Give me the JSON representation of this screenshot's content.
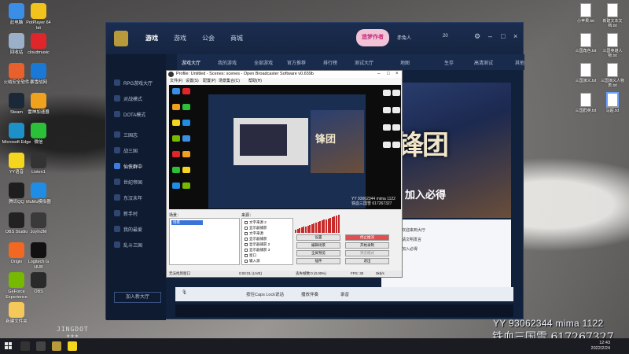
{
  "desktop_left_icons": [
    {
      "label": "此电脑",
      "color": "#3a8ee6"
    },
    {
      "label": "PotPlayer 64 bit",
      "color": "#f2c21d"
    },
    {
      "label": "回收站",
      "color": "#9ab0c8"
    },
    {
      "label": "cloudmusic",
      "color": "#e0262b"
    },
    {
      "label": "火绒安全软件",
      "color": "#e8602c"
    },
    {
      "label": "暴雪战网",
      "color": "#1a78d6"
    },
    {
      "label": "Steam",
      "color": "#1b2838"
    },
    {
      "label": "雷神加速器",
      "color": "#f0a21e"
    },
    {
      "label": "Microsoft Edge",
      "color": "#1e90c8"
    },
    {
      "label": "微信",
      "color": "#2bbf3a"
    },
    {
      "label": "YY语音",
      "color": "#f5d61e"
    },
    {
      "label": "Listen1",
      "color": "#333333"
    },
    {
      "label": "腾讯QQ",
      "color": "#1e1e1e"
    },
    {
      "label": "MuMu模拟器",
      "color": "#1f8ce6"
    },
    {
      "label": "OBS Studio",
      "color": "#222222"
    },
    {
      "label": "JoyIn2M",
      "color": "#3a3a3a"
    },
    {
      "label": "Origin",
      "color": "#f26722"
    },
    {
      "label": "Logitech G HUB",
      "color": "#111111"
    },
    {
      "label": "GeForce Experience",
      "color": "#76b900"
    },
    {
      "label": "OBS",
      "color": "#2a2a2a"
    },
    {
      "label": "新建文件夹",
      "color": "#f4c95a"
    }
  ],
  "desktop_right_icons": [
    {
      "label": "小苹果.txt"
    },
    {
      "label": "新建文本文档.txt"
    },
    {
      "label": "三国角色.txt"
    },
    {
      "label": "三国英雄人物.txt"
    },
    {
      "label": "三国演义.txt"
    },
    {
      "label": "三国演义人物表.txt"
    },
    {
      "label": "三国群英.txt"
    },
    {
      "label": "马超.txt"
    }
  ],
  "launcher": {
    "nav": [
      "游戏",
      "游戏",
      "公会",
      "商城"
    ],
    "promo": "造梦作者",
    "user": "赤兔人",
    "user_badge": "20",
    "sidebar": [
      {
        "label": "RPG游戏大厅",
        "active": false
      },
      {
        "label": "对战模式",
        "active": false
      },
      {
        "label": "DOTA模式",
        "active": false
      },
      {
        "label": "三国志",
        "active": false
      },
      {
        "label": "战三国",
        "active": false
      },
      {
        "label": "仙侠群中",
        "active": true
      },
      {
        "label": "世纪帝国",
        "active": false
      },
      {
        "label": "东汉末年",
        "active": false
      },
      {
        "label": "新手村",
        "active": false
      },
      {
        "label": "我的最爱",
        "active": false
      },
      {
        "label": "乱斗三国",
        "active": false
      }
    ],
    "add_game": "加入新大厅",
    "subtabs": [
      "游戏大厅",
      "我的游戏",
      "全部游戏",
      "官方推荐",
      "排行榜",
      "测试大厅",
      "地图",
      "生存",
      "高清测试",
      "其他"
    ],
    "banner_title": "锋团",
    "banner_sub": "加入必得",
    "chat_lines": [
      "【系统】欢迎来到大厅",
      "【公告】请文明发言",
      "【用户】加入必得"
    ],
    "toolbar": [
      "按住Caps Lock说话",
      "播放伴奏",
      "录音"
    ]
  },
  "obs": {
    "title": "Profile: Untitled - Scenes: scenes - Open Broadcaster Software v0.659b",
    "menu": [
      "文件(F)",
      "设置(S)",
      "配置(P)",
      "场景集合(C)",
      "帮助(H)"
    ],
    "scenes_header": "场景：",
    "sources_header": "来源：",
    "scene_item": "场景",
    "sources": [
      "文字来源 2",
      "显示器捕获",
      "文字来源",
      "显示器捕获",
      "显示器捕获 2",
      "显示器捕获 3",
      "窗口",
      "输入源"
    ],
    "buttons": {
      "settings": "设置",
      "start_stream": "停止推流",
      "edit_scene": "编辑场景",
      "start_record": "开始录制",
      "fullscreen_preview": "全屏预览",
      "stop_preview": "预览模式",
      "plugins": "插件",
      "exit": "退出"
    },
    "status_left": "无法找到窗口",
    "status_time": "0:00:01 (LIVE)",
    "status_dropped": "丢失帧数:0 (0.00%)",
    "status_fps": "FPS: 30",
    "status_rate": "0kb/s",
    "overlay": [
      "YY 93062344 mima 1122",
      "铁血三国雪 617267327"
    ]
  },
  "overlay_text": {
    "yy": "YY  93062344  mima  1122",
    "cn": "铁血三国雪  617267327",
    "brand": "JINGDOT",
    "stars": "★★★"
  },
  "taskbar": {
    "time": "12:43",
    "date": "2022/2/24"
  }
}
